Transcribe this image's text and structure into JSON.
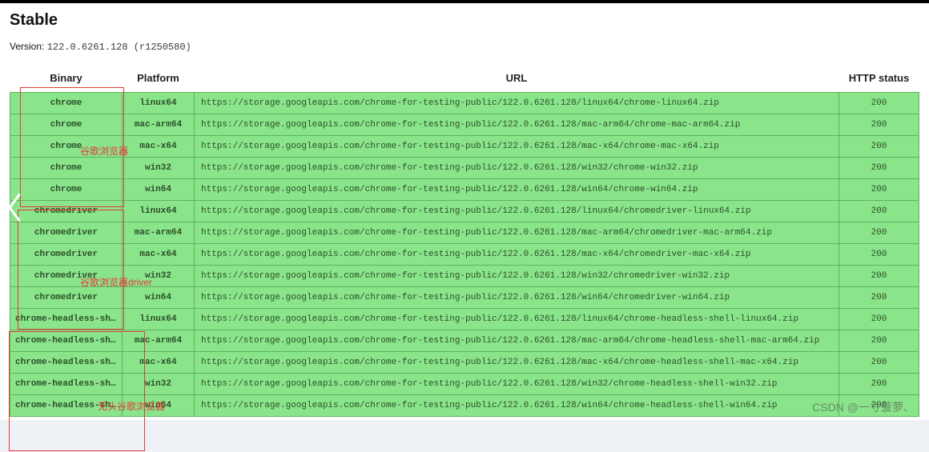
{
  "title": "Stable",
  "version_label": "Version:",
  "version_value": "122.0.6261.128 (r1250580)",
  "columns": {
    "binary": "Binary",
    "platform": "Platform",
    "url": "URL",
    "status": "HTTP status"
  },
  "rows": [
    {
      "binary": "chrome",
      "platform": "linux64",
      "url": "https://storage.googleapis.com/chrome-for-testing-public/122.0.6261.128/linux64/chrome-linux64.zip",
      "status": "200"
    },
    {
      "binary": "chrome",
      "platform": "mac-arm64",
      "url": "https://storage.googleapis.com/chrome-for-testing-public/122.0.6261.128/mac-arm64/chrome-mac-arm64.zip",
      "status": "200"
    },
    {
      "binary": "chrome",
      "platform": "mac-x64",
      "url": "https://storage.googleapis.com/chrome-for-testing-public/122.0.6261.128/mac-x64/chrome-mac-x64.zip",
      "status": "200"
    },
    {
      "binary": "chrome",
      "platform": "win32",
      "url": "https://storage.googleapis.com/chrome-for-testing-public/122.0.6261.128/win32/chrome-win32.zip",
      "status": "200"
    },
    {
      "binary": "chrome",
      "platform": "win64",
      "url": "https://storage.googleapis.com/chrome-for-testing-public/122.0.6261.128/win64/chrome-win64.zip",
      "status": "200"
    },
    {
      "binary": "chromedriver",
      "platform": "linux64",
      "url": "https://storage.googleapis.com/chrome-for-testing-public/122.0.6261.128/linux64/chromedriver-linux64.zip",
      "status": "200"
    },
    {
      "binary": "chromedriver",
      "platform": "mac-arm64",
      "url": "https://storage.googleapis.com/chrome-for-testing-public/122.0.6261.128/mac-arm64/chromedriver-mac-arm64.zip",
      "status": "200"
    },
    {
      "binary": "chromedriver",
      "platform": "mac-x64",
      "url": "https://storage.googleapis.com/chrome-for-testing-public/122.0.6261.128/mac-x64/chromedriver-mac-x64.zip",
      "status": "200"
    },
    {
      "binary": "chromedriver",
      "platform": "win32",
      "url": "https://storage.googleapis.com/chrome-for-testing-public/122.0.6261.128/win32/chromedriver-win32.zip",
      "status": "200"
    },
    {
      "binary": "chromedriver",
      "platform": "win64",
      "url": "https://storage.googleapis.com/chrome-for-testing-public/122.0.6261.128/win64/chromedriver-win64.zip",
      "status": "200"
    },
    {
      "binary": "chrome-headless-shell",
      "platform": "linux64",
      "url": "https://storage.googleapis.com/chrome-for-testing-public/122.0.6261.128/linux64/chrome-headless-shell-linux64.zip",
      "status": "200"
    },
    {
      "binary": "chrome-headless-shell",
      "platform": "mac-arm64",
      "url": "https://storage.googleapis.com/chrome-for-testing-public/122.0.6261.128/mac-arm64/chrome-headless-shell-mac-arm64.zip",
      "status": "200"
    },
    {
      "binary": "chrome-headless-shell",
      "platform": "mac-x64",
      "url": "https://storage.googleapis.com/chrome-for-testing-public/122.0.6261.128/mac-x64/chrome-headless-shell-mac-x64.zip",
      "status": "200"
    },
    {
      "binary": "chrome-headless-shell",
      "platform": "win32",
      "url": "https://storage.googleapis.com/chrome-for-testing-public/122.0.6261.128/win32/chrome-headless-shell-win32.zip",
      "status": "200"
    },
    {
      "binary": "chrome-headless-shell",
      "platform": "win64",
      "url": "https://storage.googleapis.com/chrome-for-testing-public/122.0.6261.128/win64/chrome-headless-shell-win64.zip",
      "status": "200"
    }
  ],
  "annotations": {
    "chrome_label": "谷歌浏览器",
    "driver_label": "谷歌浏览器driver",
    "headless_label": "无头谷歌浏览器"
  },
  "watermark": "CSDN @一寸菠萝、"
}
